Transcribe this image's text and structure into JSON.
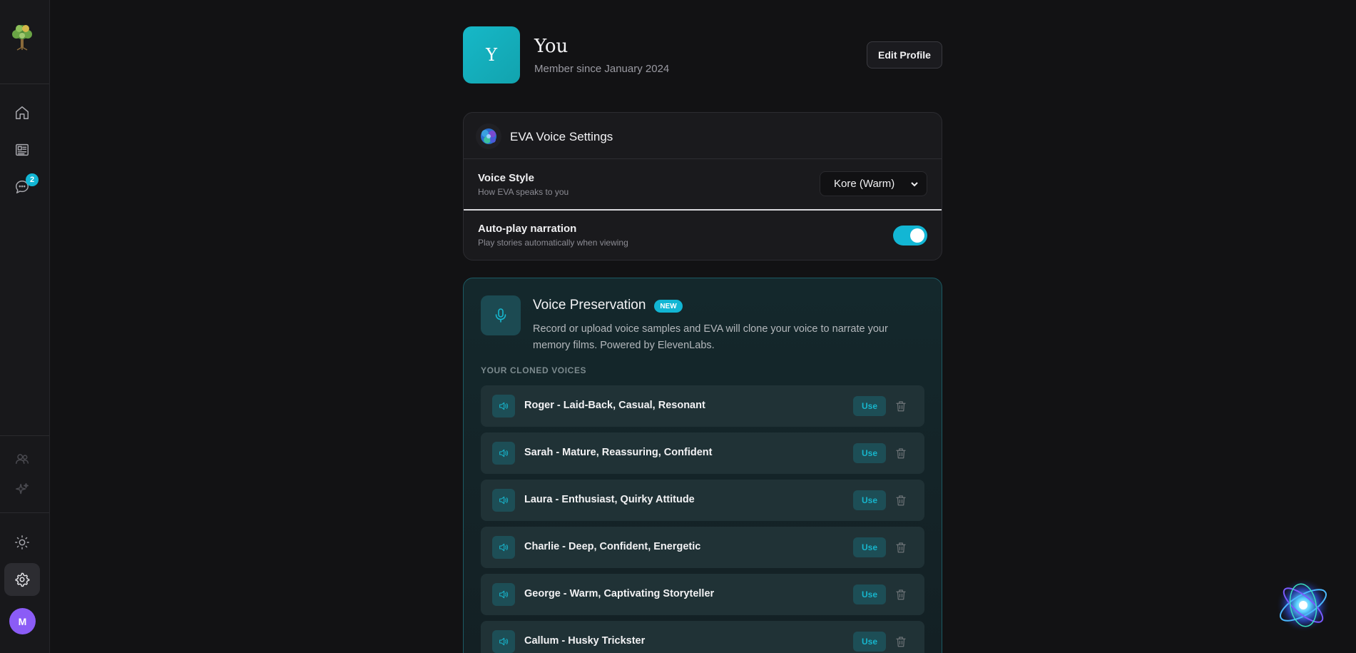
{
  "sidebar": {
    "items": [
      {
        "name": "home",
        "icon": "home-icon"
      },
      {
        "name": "stories",
        "icon": "newspaper-icon"
      },
      {
        "name": "messages",
        "icon": "chat-icon",
        "badge": "2"
      },
      {
        "name": "family",
        "icon": "people-icon"
      },
      {
        "name": "create",
        "icon": "sparkles-icon"
      },
      {
        "name": "theme",
        "icon": "sun-icon"
      },
      {
        "name": "settings",
        "icon": "gear-icon"
      }
    ],
    "user_initial": "M",
    "accent": "#12b6d4"
  },
  "profile": {
    "initial": "Y",
    "name": "You",
    "member_since": "Member since January 2024",
    "edit_label": "Edit Profile"
  },
  "voice_settings": {
    "title": "EVA Voice Settings",
    "voice_style": {
      "label": "Voice Style",
      "description": "How EVA speaks to you",
      "selected": "Kore (Warm)"
    },
    "autoplay": {
      "label": "Auto-play narration",
      "description": "Play stories automatically when viewing",
      "enabled": true
    }
  },
  "voice_preservation": {
    "title": "Voice Preservation",
    "badge": "NEW",
    "description": "Record or upload voice samples and EVA will clone your voice to narrate your memory films. Powered by ElevenLabs.",
    "section_label": "YOUR CLONED VOICES",
    "use_label": "Use",
    "voices": [
      "Roger - Laid-Back, Casual, Resonant",
      "Sarah - Mature, Reassuring, Confident",
      "Laura - Enthusiast, Quirky Attitude",
      "Charlie - Deep, Confident, Energetic",
      "George - Warm, Captivating Storyteller",
      "Callum - Husky Trickster"
    ]
  }
}
